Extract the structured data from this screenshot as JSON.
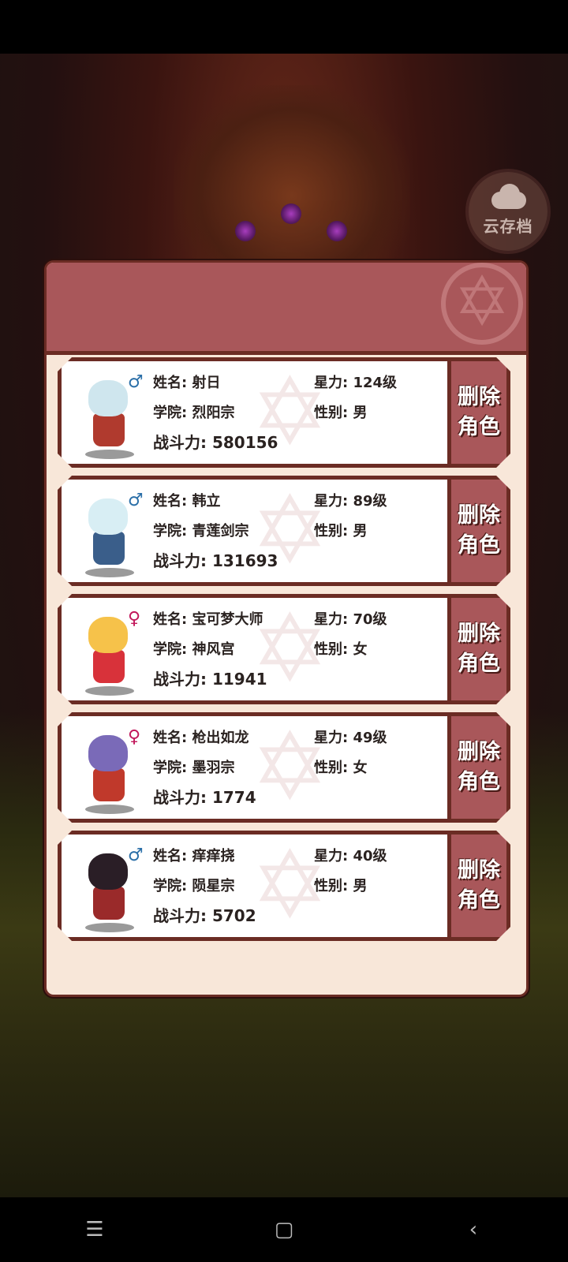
{
  "cloud_save": {
    "label": "云存档",
    "icon": "cloud-icon"
  },
  "labels": {
    "name": "姓名: ",
    "academy": "学院: ",
    "power": "战斗力: ",
    "star": "星力: ",
    "gender": "性别: ",
    "delete_line1": "删除",
    "delete_line2": "角色"
  },
  "characters": [
    {
      "name": "射日",
      "academy": "烈阳宗",
      "power": "580156",
      "star": "124级",
      "gender": "男",
      "gender_icon": "♂",
      "gender_color": "#2b6fa8",
      "hair": "#cfe6ee",
      "outfit": "#b03a2e"
    },
    {
      "name": "韩立",
      "academy": "青莲剑宗",
      "power": "131693",
      "star": "89级",
      "gender": "男",
      "gender_icon": "♂",
      "gender_color": "#2b6fa8",
      "hair": "#d8eef4",
      "outfit": "#3a5e8a"
    },
    {
      "name": "宝可梦大师",
      "academy": "神风宫",
      "power": "11941",
      "star": "70级",
      "gender": "女",
      "gender_icon": "♀",
      "gender_color": "#c2185b",
      "hair": "#f6c24a",
      "outfit": "#d8323a"
    },
    {
      "name": "枪出如龙",
      "academy": "墨羽宗",
      "power": "1774",
      "star": "49级",
      "gender": "女",
      "gender_icon": "♀",
      "gender_color": "#c2185b",
      "hair": "#7a6ab8",
      "outfit": "#c0392b"
    },
    {
      "name": "痒痒挠",
      "academy": "陨星宗",
      "power": "5702",
      "star": "40级",
      "gender": "男",
      "gender_icon": "♂",
      "gender_color": "#2b6fa8",
      "hair": "#2a1e26",
      "outfit": "#9a2a2a"
    }
  ],
  "system_nav": {
    "menu_icon": "☰",
    "home_icon": "▢",
    "back_icon": "‹"
  }
}
